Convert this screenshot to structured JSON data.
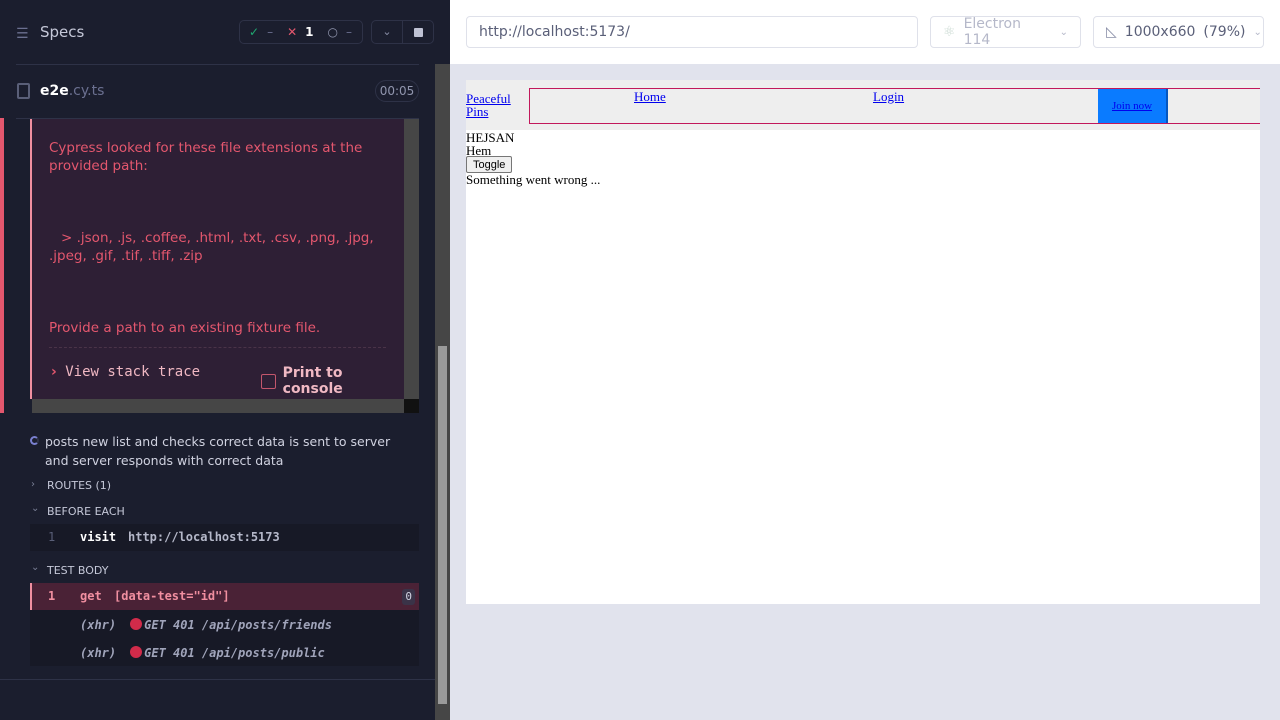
{
  "reporter": {
    "title": "Specs",
    "stats": {
      "passed": "–",
      "failed": "1",
      "pending": "–"
    },
    "spec": {
      "name_bold": "e2e",
      "name_ext": ".cy.ts",
      "duration": "00:05"
    },
    "error": {
      "line1": "Cypress looked for these file extensions at the provided path:",
      "line2": "> .json, .js, .coffee, .html, .txt, .csv, .png, .jpg, .jpeg, .gif, .tif, .tiff, .zip",
      "line3": "Provide a path to an existing fixture file.",
      "stack_trace": "View stack trace",
      "print_console": "Print to console"
    },
    "test_title": "posts new list and checks correct data is sent to server and server responds with correct data",
    "routes": "ROUTES (1)",
    "before_each": "BEFORE EACH",
    "before_cmd": {
      "num": "1",
      "name": "visit",
      "arg": "http://localhost:5173"
    },
    "test_body": "TEST BODY",
    "body_cmd": {
      "num": "1",
      "name": "get",
      "arg": "[data-test=\"id\"]",
      "count": "0"
    },
    "xhr": [
      {
        "label": "(xhr)",
        "text": "GET 401 /api/posts/friends"
      },
      {
        "label": "(xhr)",
        "text": "GET 401 /api/posts/public"
      }
    ]
  },
  "browser": {
    "url": "http://localhost:5173/",
    "engine": "Electron 114",
    "viewport": "1000x660",
    "scale": "(79%)"
  },
  "app": {
    "brand": "Peaceful Pins",
    "nav": [
      "Home",
      "Login"
    ],
    "join": "Join now",
    "text1": "HEJSAN",
    "text2": "Hem",
    "toggle": "Toggle",
    "error": "Something went wrong ..."
  },
  "colors": {
    "error": "#e4576e",
    "accent": "#0a7bff"
  }
}
